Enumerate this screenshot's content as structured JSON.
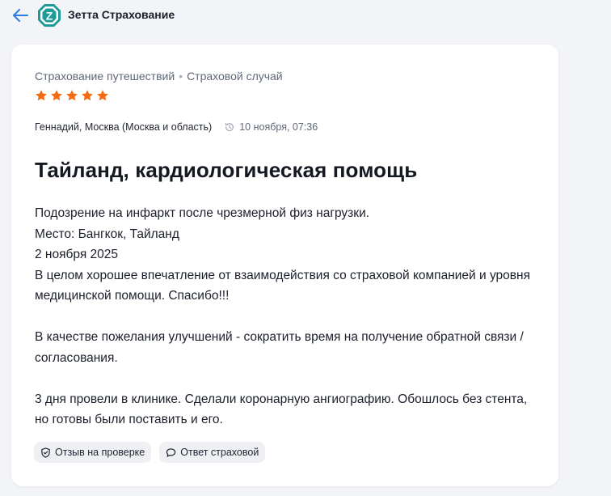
{
  "header": {
    "company_name": "Зетта Страхование",
    "logo_letter": "Z",
    "back_icon": "arrow-left-icon"
  },
  "review": {
    "breadcrumb": {
      "category": "Страхование путешествий",
      "separator": "•",
      "subcategory": "Страховой случай"
    },
    "rating": 5,
    "rating_max": 5,
    "author": "Геннадий, Москва (Москва и область)",
    "date": "10 ноября, 07:36",
    "title": "Тайланд, кардиологическая помощь",
    "body": {
      "line1": "Подозрение на инфаркт после чрезмерной физ нагрузки.",
      "line2": "Место: Бангкок, Тайланд",
      "line3": "2 ноября 2025",
      "line4": "В целом хорошее впечатление от взаимодействия со страховой компанией и уровня медицинской помощи. Спасибо!!!",
      "para2": "В качестве пожелания улучшений - сократить время на получение обратной связи / согласования.",
      "para3": "3 дня провели в клинике. Сделали коронарную ангиографию. Обошлось без стента, но готовы были поставить и его."
    },
    "tags": {
      "status_label": "Отзыв на проверке",
      "status_icon": "shield-check-icon",
      "reply_label": "Ответ страховой",
      "reply_icon": "speech-bubble-icon"
    }
  },
  "colors": {
    "star": "#f26a12",
    "logo_bg": "#1c9b98",
    "back_arrow": "#2a7de1",
    "page_bg": "#f3f4f7",
    "card_bg": "#ffffff",
    "tag_bg": "#eef0f4"
  }
}
